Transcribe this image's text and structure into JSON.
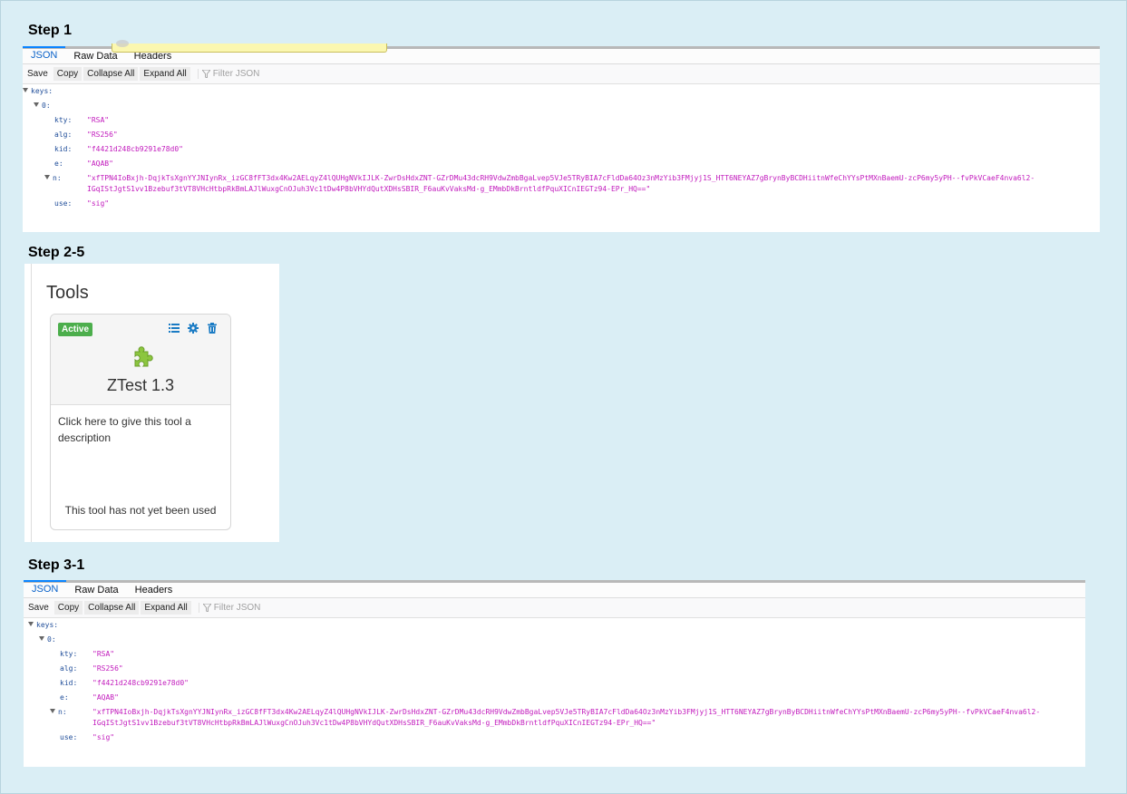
{
  "steps": {
    "step1": "Step 1",
    "step2": "Step 2-5",
    "step3": "Step 3-1"
  },
  "viewer": {
    "tabs": [
      "JSON",
      "Raw Data",
      "Headers"
    ],
    "toolbar": {
      "save": "Save",
      "copy": "Copy",
      "collapse_all": "Collapse All",
      "expand_all": "Expand All",
      "filter_placeholder": "Filter JSON"
    },
    "tree": {
      "root_key": "keys:",
      "index_key": "0:",
      "entries": [
        {
          "key": "kty:",
          "value": "\"RSA\""
        },
        {
          "key": "alg:",
          "value": "\"RS256\""
        },
        {
          "key": "kid:",
          "value": "\"f4421d248cb9291e78d0\""
        },
        {
          "key": "e:",
          "value": "\"AQAB\""
        },
        {
          "key": "n:",
          "value_line1": "\"xfTPN4IoBxjh-DqjkTsXgnYYJNIynRx_izGC8fFT3dx4Kw2AELqyZ4lQUHgNVkIJLK-ZwrDsHdxZNT-GZrDMu43dcRH9VdwZmbBgaLvep5VJe5TRyBIA7cFldDa64Oz3nMzYib3FMjyj1S_HTT6NEYAZ7gBrynByBCDHiitnWfeChYYsPtMXnBaemU-zcP6my5yPH--fvPkVCaeF4nva6l2-",
          "value_line2": "IGqIStJgtS1vv1Bzebuf3tVT8VHcHtbpRkBmLAJlWuxgCnOJuh3Vc1tDw4P8bVHYdQutXDHsSBIR_F6auKvVaksMd-g_EMmbDkBrntldfPquXICnIEGTz94-EPr_HQ==\""
        },
        {
          "key": "use:",
          "value": "\"sig\""
        }
      ]
    }
  },
  "tools": {
    "title": "Tools",
    "card": {
      "badge": "Active",
      "name": "ZTest 1.3",
      "description": "Click here to give this tool a description",
      "usage": "This tool has not yet been used"
    },
    "icons": [
      "list-icon",
      "gear-icon",
      "trash-icon",
      "puzzle-icon"
    ],
    "colors": {
      "accent": "#1a7bc4",
      "badge": "#4cae4c",
      "puzzle": "#8cc63f"
    }
  }
}
